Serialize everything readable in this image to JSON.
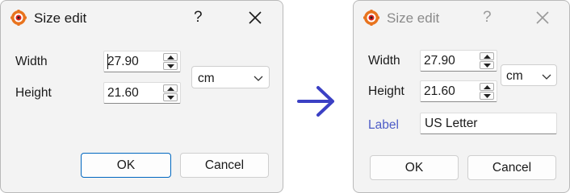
{
  "dialog_before": {
    "title": "Size edit",
    "help": "?",
    "width_label": "Width",
    "width_value": "27.90",
    "height_label": "Height",
    "height_value": "21.60",
    "unit": "cm",
    "ok": "OK",
    "cancel": "Cancel"
  },
  "dialog_after": {
    "title": "Size edit",
    "help": "?",
    "width_label": "Width",
    "width_value": "27.90",
    "height_label": "Height",
    "height_value": "21.60",
    "unit": "cm",
    "label_label": "Label",
    "label_value": "US Letter",
    "ok": "OK",
    "cancel": "Cancel"
  },
  "colors": {
    "accent": "#0067c0",
    "label_link": "#4d5cc7",
    "arrow": "#3b40c4"
  },
  "icons": {
    "app": "gear-eye-icon",
    "close": "close-icon",
    "spin_up": "triangle-up-icon",
    "spin_down": "triangle-down-icon",
    "dropdown": "chevron-down-icon",
    "transition": "arrow-right-icon"
  }
}
